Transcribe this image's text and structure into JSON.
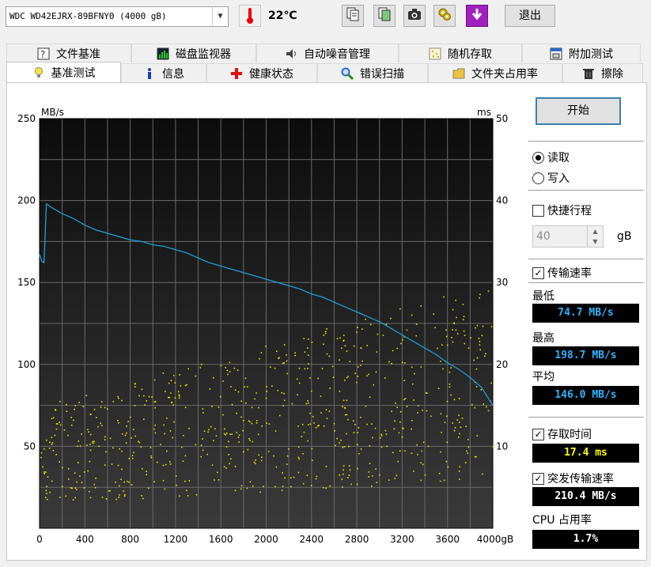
{
  "toolbar": {
    "drive": "WDC WD42EJRX-89BFNY0 (4000 gB)",
    "temperature": "22℃",
    "exit_label": "退出"
  },
  "tabs_row1": [
    {
      "label": "文件基准",
      "icon": "benchmark-file-icon"
    },
    {
      "label": "磁盘监视器",
      "icon": "disk-monitor-icon"
    },
    {
      "label": "自动噪音管理",
      "icon": "speaker-icon"
    },
    {
      "label": "随机存取",
      "icon": "random-access-icon"
    },
    {
      "label": "附加测试",
      "icon": "extra-tests-icon"
    }
  ],
  "tabs_row2": [
    {
      "label": "基准测试",
      "icon": "lightbulb-icon",
      "active": true
    },
    {
      "label": "信息",
      "icon": "info-icon"
    },
    {
      "label": "健康状态",
      "icon": "health-cross-icon"
    },
    {
      "label": "错误扫描",
      "icon": "magnifier-icon"
    },
    {
      "label": "文件夹占用率",
      "icon": "folder-icon"
    },
    {
      "label": "擦除",
      "icon": "trash-icon"
    }
  ],
  "controls": {
    "start_label": "开始",
    "read_label": "读取",
    "write_label": "写入",
    "mode": "read",
    "short_stroke_label": "快捷行程",
    "short_stroke_checked": false,
    "short_stroke_value": "40",
    "short_stroke_unit": "gB",
    "transfer_rate_label": "传输速率",
    "transfer_rate_checked": true,
    "access_time_label": "存取时间",
    "access_time_checked": true,
    "burst_rate_label": "突发传输速率",
    "burst_rate_checked": true
  },
  "stats": {
    "min_label": "最低",
    "min_value": "74.7 MB/s",
    "max_label": "最高",
    "max_value": "198.7 MB/s",
    "avg_label": "平均",
    "avg_value": "146.0 MB/s",
    "access_value": "17.4 ms",
    "burst_value": "210.4 MB/s",
    "cpu_label": "CPU 占用率",
    "cpu_value": "1.7%"
  },
  "colors": {
    "transfer_line": "#1e9fd8",
    "access_dots": "#e6e600",
    "lcd_blue": "#2db4ff",
    "lcd_yellow": "#ffff00",
    "lcd_white": "#ffffff"
  },
  "chart_data": {
    "type": "line",
    "y_left_unit": "MB/s",
    "y_right_unit": "ms",
    "x_unit": "gB",
    "ylim_left": [
      0,
      250
    ],
    "ylim_right": [
      0,
      50
    ],
    "xlim": [
      0,
      4000
    ],
    "y_left_ticks": [
      "50",
      "100",
      "150",
      "200",
      "250"
    ],
    "y_right_ticks": [
      "10",
      "20",
      "30",
      "40",
      "50"
    ],
    "x_ticks": [
      "0",
      "400",
      "800",
      "1200",
      "1600",
      "2000",
      "2400",
      "2800",
      "3200",
      "3600",
      "4000gB"
    ],
    "grid": true,
    "series": [
      {
        "name": "传输速率",
        "x": [
          0,
          20,
          40,
          60,
          100,
          200,
          300,
          400,
          500,
          600,
          700,
          800,
          900,
          1000,
          1100,
          1200,
          1300,
          1400,
          1500,
          1600,
          1700,
          1800,
          1900,
          2000,
          2100,
          2200,
          2300,
          2400,
          2500,
          2600,
          2700,
          2800,
          2900,
          3000,
          3100,
          3200,
          3300,
          3400,
          3500,
          3600,
          3700,
          3800,
          3900,
          4000
        ],
        "values": [
          167,
          163,
          162,
          198,
          196,
          192,
          189,
          185,
          182,
          180,
          178,
          176,
          175,
          173,
          172,
          170,
          168,
          165,
          162,
          160,
          158,
          156,
          154,
          152,
          150,
          148,
          146,
          143,
          141,
          138,
          135,
          132,
          129,
          126,
          122,
          118,
          114,
          110,
          106,
          101,
          97,
          92,
          86,
          75
        ]
      },
      {
        "name": "存取时间",
        "x": [],
        "values": []
      }
    ]
  }
}
